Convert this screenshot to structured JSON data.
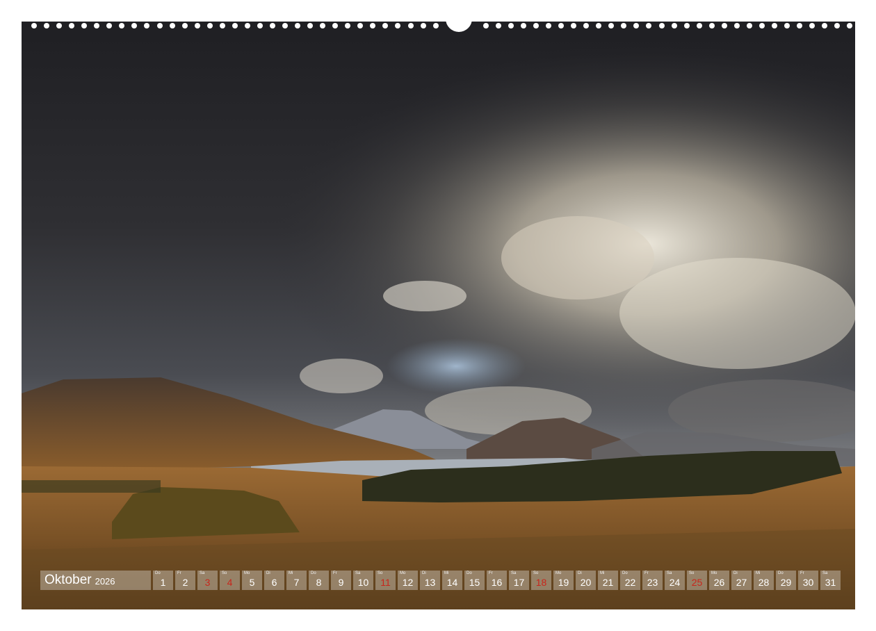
{
  "calendar": {
    "month": "Oktober",
    "year": "2026",
    "days": [
      {
        "n": "1",
        "dow": "Do",
        "red": false
      },
      {
        "n": "2",
        "dow": "Fr",
        "red": false
      },
      {
        "n": "3",
        "dow": "Sa",
        "red": true
      },
      {
        "n": "4",
        "dow": "So",
        "red": true
      },
      {
        "n": "5",
        "dow": "Mo",
        "red": false
      },
      {
        "n": "6",
        "dow": "Di",
        "red": false
      },
      {
        "n": "7",
        "dow": "Mi",
        "red": false
      },
      {
        "n": "8",
        "dow": "Do",
        "red": false
      },
      {
        "n": "9",
        "dow": "Fr",
        "red": false
      },
      {
        "n": "10",
        "dow": "Sa",
        "red": false
      },
      {
        "n": "11",
        "dow": "So",
        "red": true
      },
      {
        "n": "12",
        "dow": "Mo",
        "red": false
      },
      {
        "n": "13",
        "dow": "Di",
        "red": false
      },
      {
        "n": "14",
        "dow": "Mi",
        "red": false
      },
      {
        "n": "15",
        "dow": "Do",
        "red": false
      },
      {
        "n": "16",
        "dow": "Fr",
        "red": false
      },
      {
        "n": "17",
        "dow": "Sa",
        "red": false
      },
      {
        "n": "18",
        "dow": "So",
        "red": true
      },
      {
        "n": "19",
        "dow": "Mo",
        "red": false
      },
      {
        "n": "20",
        "dow": "Di",
        "red": false
      },
      {
        "n": "21",
        "dow": "Mi",
        "red": false
      },
      {
        "n": "22",
        "dow": "Do",
        "red": false
      },
      {
        "n": "23",
        "dow": "Fr",
        "red": false
      },
      {
        "n": "24",
        "dow": "Sa",
        "red": false
      },
      {
        "n": "25",
        "dow": "So",
        "red": true
      },
      {
        "n": "26",
        "dow": "Mo",
        "red": false
      },
      {
        "n": "27",
        "dow": "Di",
        "red": false
      },
      {
        "n": "28",
        "dow": "Mi",
        "red": false
      },
      {
        "n": "29",
        "dow": "Do",
        "red": false
      },
      {
        "n": "30",
        "dow": "Fr",
        "red": false
      },
      {
        "n": "31",
        "dow": "Sa",
        "red": false
      }
    ]
  },
  "colors": {
    "holiday": "#c8261c",
    "cell_background": "#dcd7cd",
    "sky_dark": "#242428",
    "moor": "#8a5a26"
  }
}
